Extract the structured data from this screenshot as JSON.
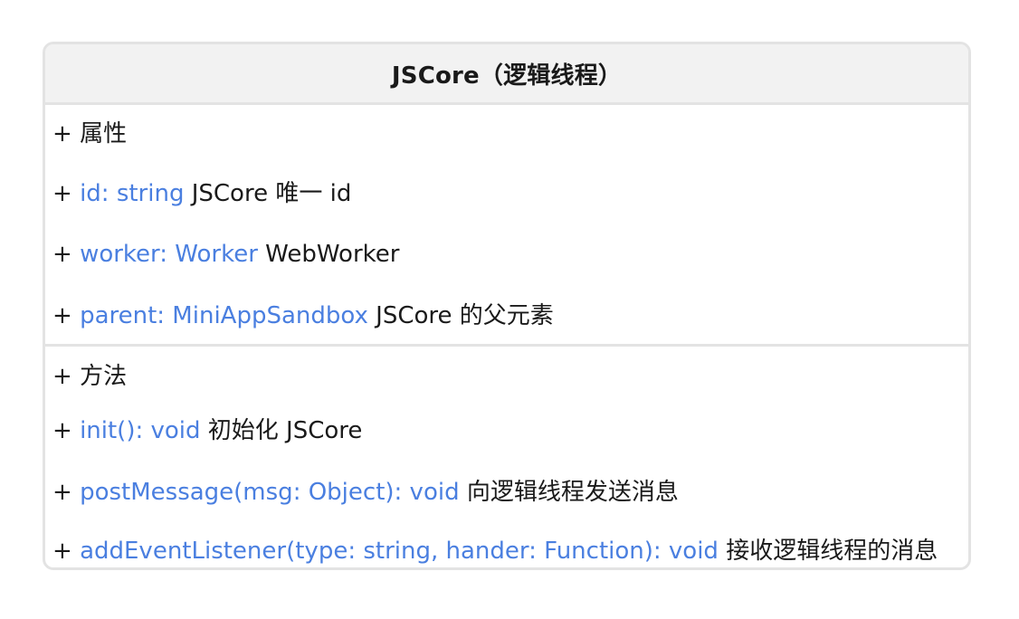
{
  "class": {
    "title": "JSCore（逻辑线程）"
  },
  "attributes": {
    "heading": "属性",
    "items": [
      {
        "signature": "id: string",
        "description": "JSCore 唯一 id"
      },
      {
        "signature": "worker: Worker",
        "description": "WebWorker"
      },
      {
        "signature": "parent: MiniAppSandbox",
        "description": "JSCore 的父元素"
      }
    ]
  },
  "methods": {
    "heading": "方法",
    "items": [
      {
        "signature": "init(): void",
        "description": "初始化 JSCore"
      },
      {
        "signature": "postMessage(msg: Object): void",
        "description": "向逻辑线程发送消息"
      },
      {
        "signature": "addEventListener(type: string, hander: Function): void",
        "description": "接收逻辑线程的消息"
      }
    ]
  },
  "colors": {
    "signature": "#4a7fe0",
    "text": "#1a1a1a",
    "header_bg": "#f2f2f2",
    "border": "#e3e3e3"
  }
}
